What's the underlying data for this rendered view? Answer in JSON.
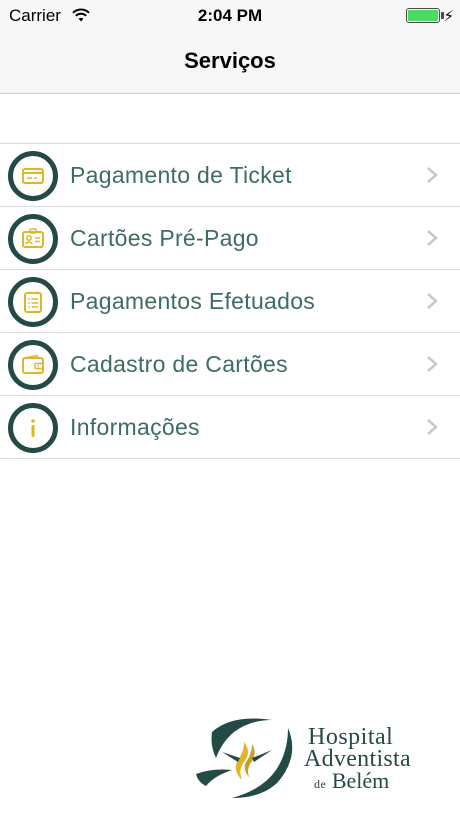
{
  "status_bar": {
    "carrier": "Carrier",
    "time": "2:04 PM",
    "battery_level": 1.0,
    "charging": true
  },
  "nav": {
    "title": "Serviços"
  },
  "menu": [
    {
      "label": "Pagamento de Ticket",
      "icon": "ticket-card-icon"
    },
    {
      "label": "Cartões Pré-Pago",
      "icon": "id-card-icon"
    },
    {
      "label": "Pagamentos Efetuados",
      "icon": "receipt-list-icon"
    },
    {
      "label": "Cadastro de Cartões",
      "icon": "wallet-icon"
    },
    {
      "label": "Informações",
      "icon": "info-icon"
    }
  ],
  "logo": {
    "line1": "Hospital",
    "line2": "Adventista",
    "line3_prefix": "de",
    "line3": "Belém"
  },
  "colors": {
    "icon_ring": "#244a45",
    "icon_glyph": "#e0b52a",
    "label": "#3d6b66",
    "logo_text": "#264b47",
    "battery": "#4cd964"
  }
}
